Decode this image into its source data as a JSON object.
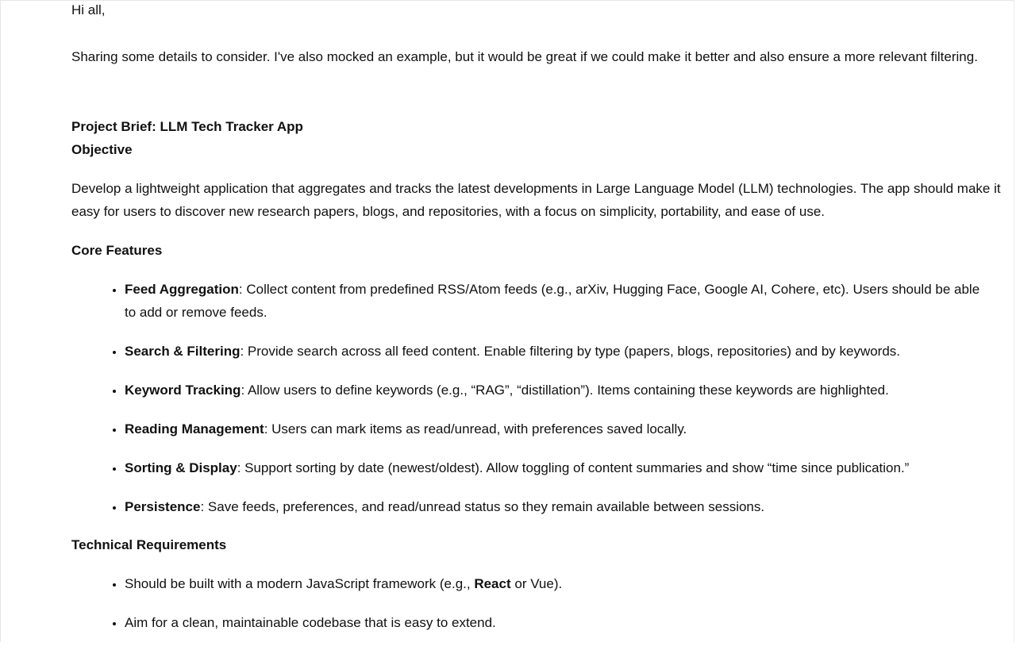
{
  "greeting": "Hi all,",
  "intro": "Sharing some details to consider. I've also mocked an example, but it would be great if we could make it better and also ensure a more relevant filtering.",
  "brief_title": "Project Brief: LLM Tech Tracker App",
  "objective": {
    "heading": "Objective",
    "text": "Develop a lightweight application that aggregates and tracks the latest developments in Large Language Model (LLM) technologies. The app should make it easy for users to discover new research papers, blogs, and repositories, with a focus on simplicity, portability, and ease of use."
  },
  "core_features": {
    "heading": "Core Features",
    "items": [
      {
        "term": "Feed Aggregation",
        "text": ": Collect content from predefined RSS/Atom feeds (e.g., arXiv, Hugging Face, Google AI, Cohere, etc). Users should be able to add or remove feeds."
      },
      {
        "term": "Search & Filtering",
        "text": ": Provide search across all feed content. Enable filtering by type (papers, blogs, repositories) and by keywords."
      },
      {
        "term": "Keyword Tracking",
        "text": ": Allow users to define keywords (e.g., “RAG”, “distillation”). Items containing these keywords are highlighted."
      },
      {
        "term": "Reading Management",
        "text": ": Users can mark items as read/unread, with preferences saved locally."
      },
      {
        "term": "Sorting & Display",
        "text": ": Support sorting by date (newest/oldest). Allow toggling of content summaries and show “time since publication.”"
      },
      {
        "term": "Persistence",
        "text": ": Save feeds, preferences, and read/unread status so they remain available between sessions."
      }
    ]
  },
  "technical_requirements": {
    "heading": "Technical Requirements",
    "items": [
      {
        "before": "Should be built with a modern JavaScript framework (e.g., ",
        "bold": "React",
        "after": " or Vue)."
      },
      {
        "text": "Aim for a clean, maintainable codebase that is easy to extend."
      }
    ]
  }
}
